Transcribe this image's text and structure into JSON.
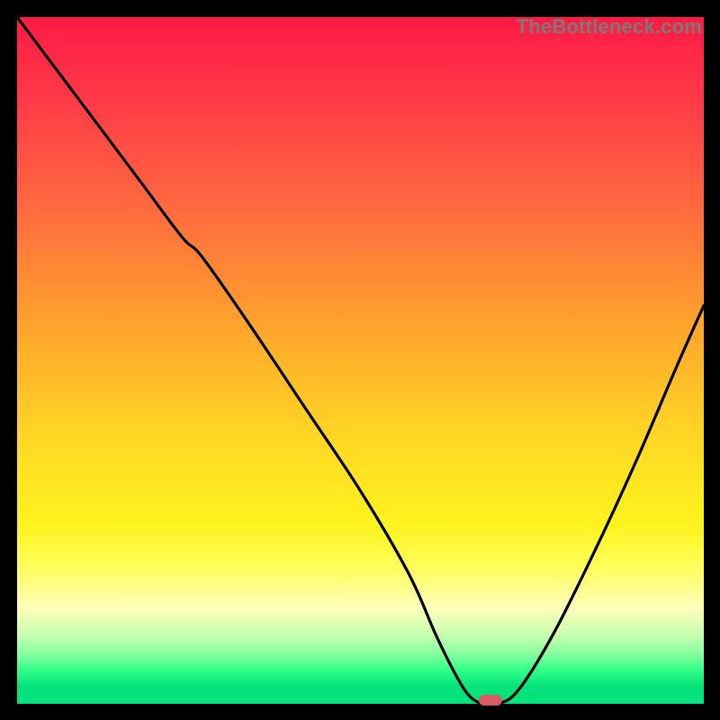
{
  "watermark": "TheBottleneck.com",
  "colors": {
    "background": "#000000",
    "curve_stroke": "#000000",
    "marker_fill": "#d85a63",
    "watermark_text": "#7a7a7a"
  },
  "chart_data": {
    "type": "line",
    "title": "",
    "xlabel": "",
    "ylabel": "",
    "xlim": [
      0,
      100
    ],
    "ylim": [
      0,
      100
    ],
    "grid": false,
    "gradient_background": {
      "direction": "vertical",
      "stops": [
        {
          "pos": 0,
          "color": "#ff1a44",
          "meaning": "high-bottleneck"
        },
        {
          "pos": 50,
          "color": "#ffd000",
          "meaning": "moderate"
        },
        {
          "pos": 95,
          "color": "#04e37a",
          "meaning": "optimal"
        }
      ]
    },
    "series": [
      {
        "name": "bottleneck-curve",
        "x": [
          0,
          6,
          12,
          18,
          24,
          27,
          34,
          42,
          50,
          57,
          61,
          64,
          66,
          68,
          70,
          73,
          78,
          84,
          90,
          96,
          100
        ],
        "y": [
          100,
          92,
          84,
          76,
          68,
          65,
          55,
          43,
          31,
          19,
          10,
          4,
          1,
          0,
          0,
          2,
          10,
          22,
          35,
          49,
          58
        ]
      }
    ],
    "marker": {
      "x": 69,
      "y": 0,
      "name": "optimal-point"
    }
  }
}
